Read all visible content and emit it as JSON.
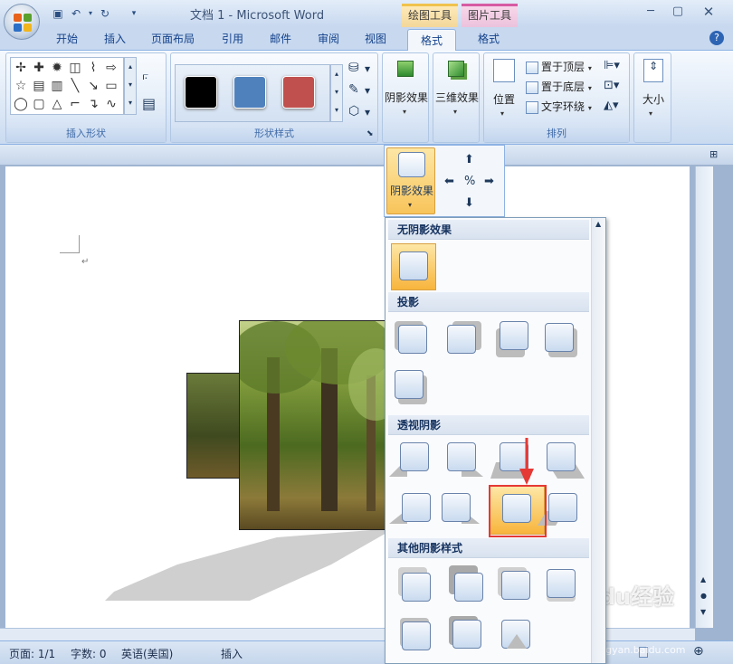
{
  "window": {
    "title": "文档 1 - Microsoft Word",
    "ctx_tab_draw": "绘图工具",
    "ctx_tab_pic": "图片工具"
  },
  "tabs": [
    "开始",
    "插入",
    "页面布局",
    "引用",
    "邮件",
    "审阅",
    "视图",
    "格式",
    "格式"
  ],
  "ribbon": {
    "group_insert_shapes": "插入形状",
    "group_shape_styles": "形状样式",
    "group_shadow_label": "阴影效果",
    "group_3d_label": "三维效果",
    "position_label": "位置",
    "bring_front": "置于顶层",
    "send_back": "置于底层",
    "text_wrap": "文字环绕",
    "arrange_group": "排列",
    "size_label": "大小",
    "swatches": [
      "#000000",
      "#4f81bd",
      "#c0504d"
    ]
  },
  "gallery": {
    "shadow_btn_label": "阴影效果"
  },
  "dropdown": {
    "sections": [
      "无阴影效果",
      "投影",
      "透视阴影",
      "其他阴影样式"
    ]
  },
  "status": {
    "page": "页面: 1/1",
    "words": "字数: 0",
    "lang": "英语(美国)",
    "mode": "插入"
  },
  "watermark": {
    "brand": "Baidu经验",
    "url": "jingyan.baidu.com"
  }
}
